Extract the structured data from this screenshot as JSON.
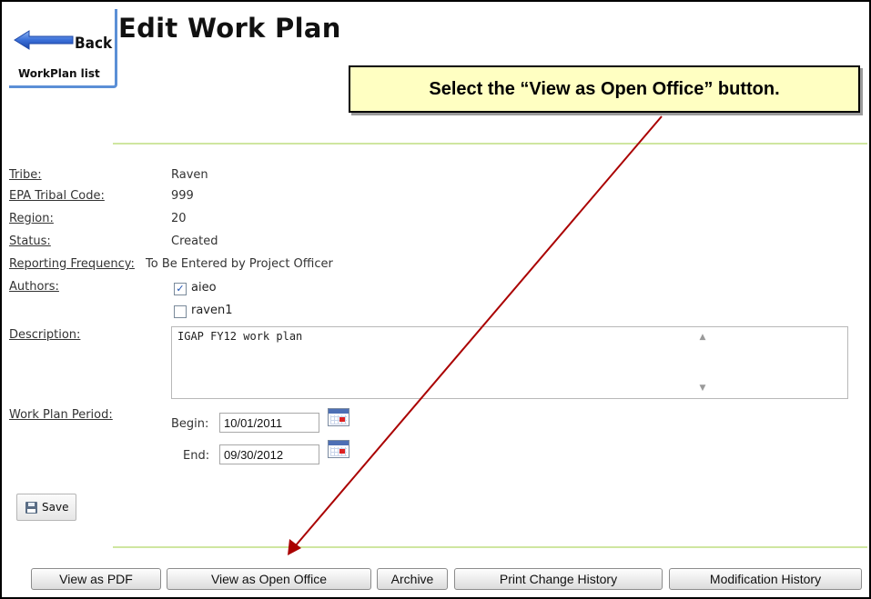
{
  "back": {
    "label": "Back",
    "sublabel": "WorkPlan list"
  },
  "page_title": "Edit Work Plan",
  "callout": "Select the “View as Open Office” button.",
  "fields": {
    "tribe": {
      "label": "Tribe:",
      "value": "Raven"
    },
    "epa_code": {
      "label": "EPA Tribal Code:",
      "value": "999"
    },
    "region": {
      "label": "Region:",
      "value": "20"
    },
    "status": {
      "label": "Status:",
      "value": "Created"
    },
    "reporting": {
      "label": "Reporting Frequency:",
      "value": "To Be Entered by Project Officer"
    },
    "authors": {
      "label": "Authors:",
      "items": [
        {
          "name": "aieo",
          "checked": true
        },
        {
          "name": "raven1",
          "checked": false
        }
      ]
    },
    "description": {
      "label": "Description:",
      "value": "IGAP FY12 work plan"
    },
    "period": {
      "label": "Work Plan Period:",
      "begin_label": "Begin:",
      "begin": "10/01/2011",
      "end_label": "End:",
      "end": "09/30/2012"
    }
  },
  "save_label": "Save",
  "buttons": {
    "pdf": "View as PDF",
    "open_office": "View as Open Office",
    "archive": "Archive",
    "print_history": "Print Change History",
    "mod_history": "Modification History"
  },
  "colors": {
    "callout_bg": "#ffffc2",
    "arrow": "#aa0000",
    "rule": "#cfe6a0",
    "back_arrow": "#3a6fd8"
  },
  "icons": {
    "back": "back-arrow-icon",
    "calendar": "calendar-icon",
    "save": "floppy-disk-icon"
  }
}
